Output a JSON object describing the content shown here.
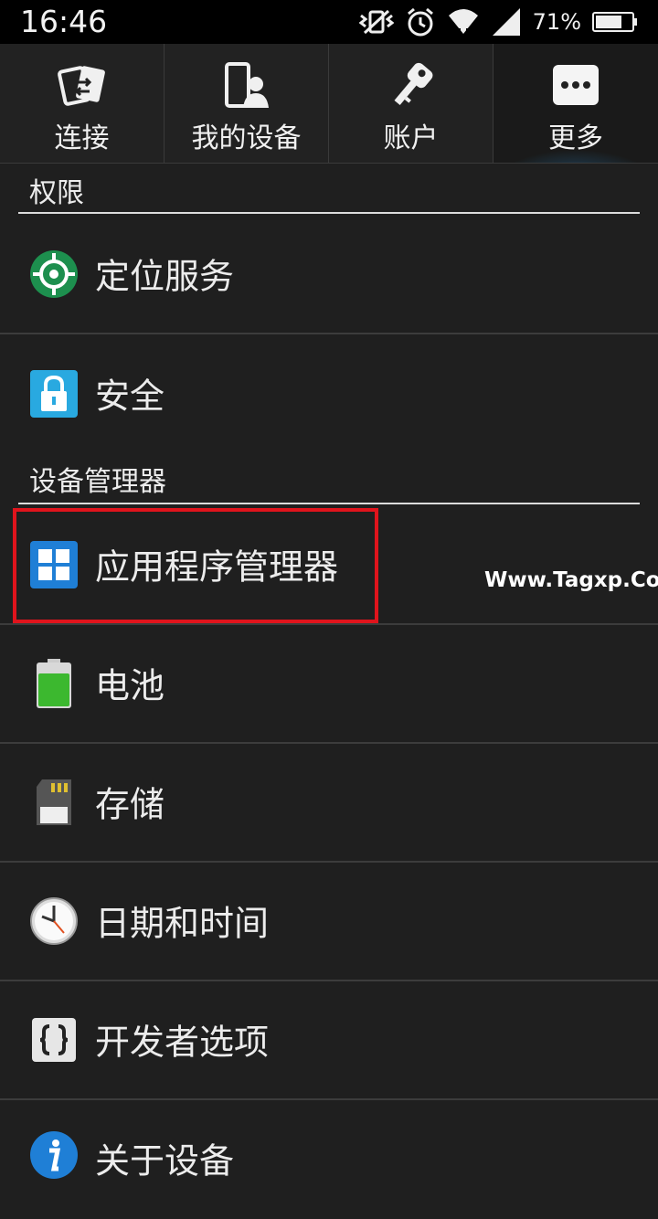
{
  "status_bar": {
    "time": "16:46",
    "battery_percent": "71%",
    "icons": [
      "vibrate-icon",
      "alarm-icon",
      "wifi-icon",
      "signal-icon",
      "battery-icon"
    ]
  },
  "tabs": [
    {
      "label": "连接",
      "icon": "connection-icon",
      "active": false
    },
    {
      "label": "我的设备",
      "icon": "my-device-icon",
      "active": false
    },
    {
      "label": "账户",
      "icon": "key-icon",
      "active": false
    },
    {
      "label": "更多",
      "icon": "more-icon",
      "active": true
    }
  ],
  "sections": {
    "permissions": "权限",
    "device_manager": "设备管理器"
  },
  "items": {
    "location": "定位服务",
    "security": "安全",
    "app_manager": "应用程序管理器",
    "battery": "电池",
    "storage": "存储",
    "date_time": "日期和时间",
    "developer": "开发者选项",
    "about": "关于设备"
  },
  "watermark": "Www.Tagxp.Com",
  "colors": {
    "accent_blue": "#28a0dc",
    "highlight_red": "#e0141c",
    "background": "#1f1f1f"
  }
}
